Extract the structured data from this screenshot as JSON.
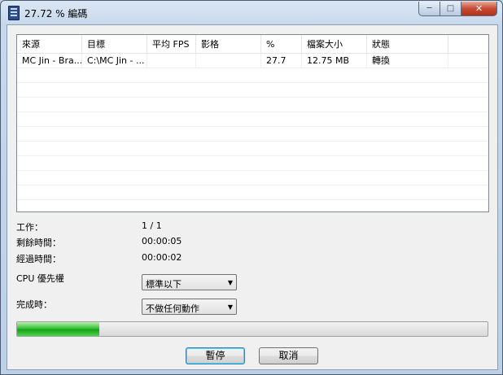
{
  "window": {
    "title": "27.72 % 編碼",
    "controls": {
      "minimize": "─",
      "maximize": "□",
      "close": "✕"
    }
  },
  "list": {
    "columns": [
      "來源",
      "目標",
      "平均 FPS",
      "影格",
      "%",
      "檔案大小",
      "狀態"
    ],
    "rows": [
      {
        "source": "MC Jin - Bra...",
        "target": "C:\\MC Jin - ...",
        "avg_fps": "",
        "frames": "",
        "percent": "27.7",
        "file_size": "12.75 MB",
        "status": "轉換"
      }
    ]
  },
  "info": {
    "job_label": "工作：",
    "job_value": "1 / 1",
    "remaining_label": "剩餘時間：",
    "remaining_value": "00:00:05",
    "elapsed_label": "經過時間：",
    "elapsed_value": "00:00:02"
  },
  "cpu_priority": {
    "label": "CPU 優先權",
    "value": "標準以下"
  },
  "on_complete": {
    "label": "完成時：",
    "value": "不做任何動作"
  },
  "progress": {
    "percent": 17.5
  },
  "buttons": {
    "pause": "暫停",
    "cancel": "取消"
  },
  "icons": {
    "app": "film-icon",
    "dropdown": "chevron-down-icon"
  }
}
